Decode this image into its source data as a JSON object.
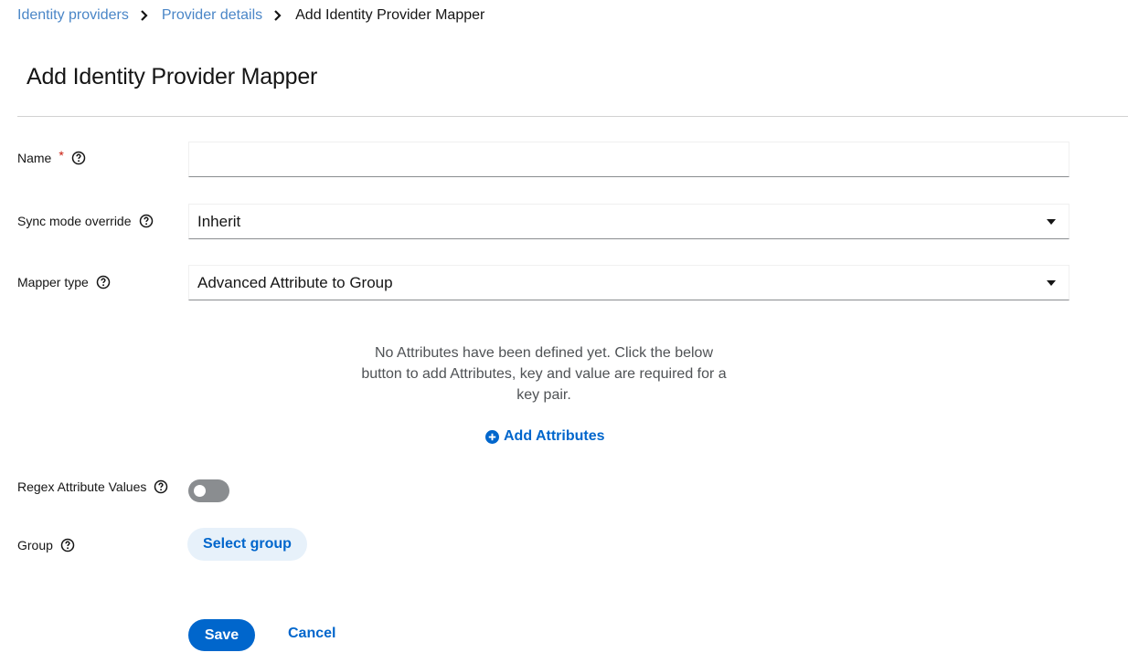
{
  "breadcrumb": {
    "items": [
      "Identity providers",
      "Provider details"
    ],
    "current": "Add Identity Provider Mapper"
  },
  "page": {
    "title": "Add Identity Provider Mapper"
  },
  "form": {
    "name": {
      "label": "Name",
      "required_mark": "*",
      "value": "",
      "placeholder": ""
    },
    "sync_mode": {
      "label": "Sync mode override",
      "value": "Inherit"
    },
    "mapper_type": {
      "label": "Mapper type",
      "value": "Advanced Attribute to Group"
    },
    "attributes": {
      "empty_message": "No Attributes have been defined yet. Click the below button to add Attributes, key and value are required for a key pair.",
      "add_label": "Add Attributes"
    },
    "regex": {
      "label": "Regex Attribute Values",
      "enabled": false
    },
    "group": {
      "label": "Group",
      "button_label": "Select group"
    }
  },
  "actions": {
    "save_label": "Save",
    "cancel_label": "Cancel"
  },
  "colors": {
    "primary": "#0066cc",
    "link": "#4a86c7",
    "required": "#c9190b",
    "toggle_off": "#8a8d90",
    "secondary_bg": "#e7f1fa"
  }
}
